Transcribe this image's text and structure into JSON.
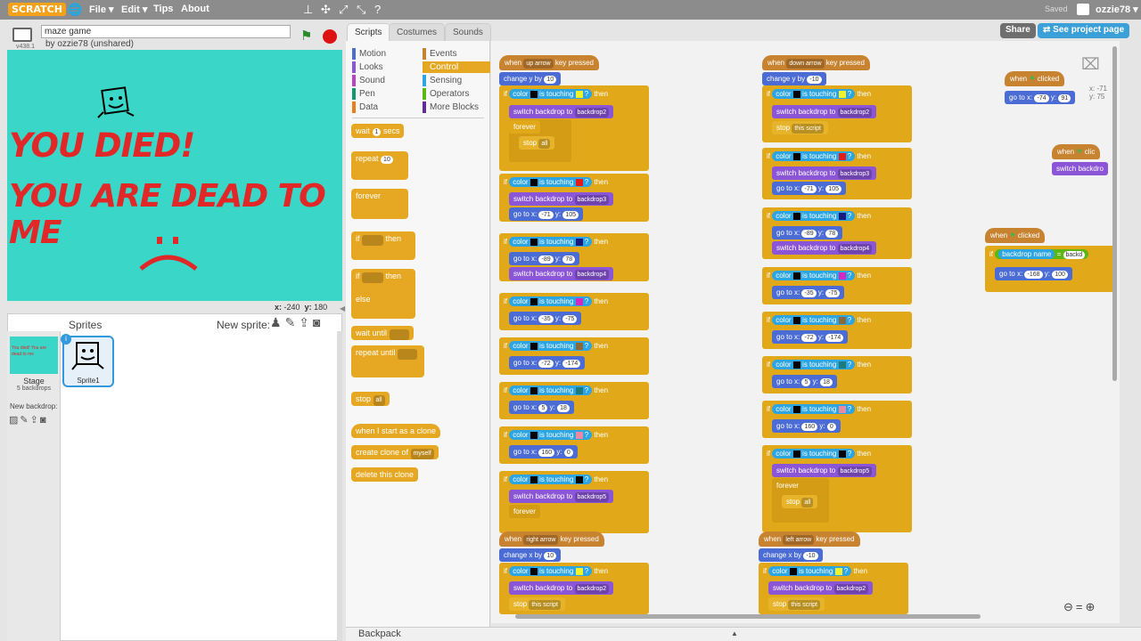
{
  "menubar": {
    "logo": "SCRATCH",
    "file": "File ▾",
    "edit": "Edit ▾",
    "tips": "Tips",
    "about": "About",
    "saved": "Saved",
    "account": "ozzie78 ▾"
  },
  "project": {
    "title": "maze game",
    "byline": "by ozzie78 (unshared)",
    "version": "v438.1"
  },
  "header_buttons": {
    "share": "Share",
    "see_project": "See project page"
  },
  "stage": {
    "line1": "YOU DIED!",
    "line2": "YOU ARE DEAD TO ME",
    "coords_x_label": "x:",
    "coords_x": "-240",
    "coords_y_label": "y:",
    "coords_y": "180"
  },
  "sprites": {
    "header": "Sprites",
    "new_sprite": "New sprite:",
    "stage_label": "Stage",
    "stage_sub": "5 backdrops",
    "new_backdrop": "New backdrop:",
    "sprite1": "Sprite1",
    "stage_thumb_text": "You died! You are dead to me"
  },
  "tabs": [
    "Scripts",
    "Costumes",
    "Sounds"
  ],
  "categories": {
    "left": [
      "Motion",
      "Looks",
      "Sound",
      "Pen",
      "Data"
    ],
    "right": [
      "Events",
      "Control",
      "Sensing",
      "Operators",
      "More Blocks"
    ],
    "colors_left": [
      "#4a6cd4",
      "#8a55d7",
      "#bb42c3",
      "#0e9a6c",
      "#ee7d16"
    ],
    "colors_right": [
      "#c88330",
      "#e1a91a",
      "#2ca5e2",
      "#5cb712",
      "#632d99"
    ]
  },
  "palette": {
    "wait": "wait",
    "wait_val": "1",
    "secs": "secs",
    "repeat": "repeat",
    "repeat_val": "10",
    "forever": "forever",
    "if": "if",
    "then": "then",
    "else": "else",
    "wait_until": "wait until",
    "repeat_until": "repeat until",
    "stop": "stop",
    "stop_val": "all",
    "when_clone": "when I start as a clone",
    "create_clone": "create clone of",
    "myself": "myself",
    "delete_clone": "delete this clone"
  },
  "backpack": "Backpack",
  "scripts": {
    "when": "when",
    "key_pressed": "key pressed",
    "up_arrow": "up arrow",
    "down_arrow": "down arrow",
    "right_arrow": "right arrow",
    "left_arrow": "left arrow",
    "change_y_by": "change y by",
    "change_x_by": "change x by",
    "v10": "10",
    "vm10": "-10",
    "if": "if",
    "then": "then",
    "color": "color",
    "is_touching": "is touching",
    "q": "?",
    "switch_backdrop_to": "switch backdrop to",
    "backdrop2": "backdrop2",
    "backdrop3": "backdrop3",
    "backdrop4": "backdrop4",
    "backdrop5": "backdrop5",
    "forever": "forever",
    "stop": "stop",
    "all": "all",
    "this_script": "this script",
    "go_to_x": "go to x:",
    "y": "y:",
    "gotos_left": [
      [
        "-71",
        "105"
      ],
      [
        "-89",
        "78"
      ],
      [
        "-35",
        "-75"
      ],
      [
        "-72",
        "-174"
      ],
      [
        "5",
        "18"
      ],
      [
        "160",
        "0"
      ]
    ],
    "gotos_right": [
      [
        "-71",
        "105"
      ],
      [
        "-89",
        "78"
      ],
      [
        "-35",
        "-75"
      ],
      [
        "-72",
        "-174"
      ],
      [
        "5",
        "18"
      ],
      [
        "160",
        "0"
      ]
    ],
    "clicked": "clicked",
    "flag_goto": [
      "-74",
      "91"
    ],
    "switch_backdro": "switch backdro",
    "backdrop_name": "backdrop name",
    "backd": "backd",
    "last_goto": [
      "-168",
      "100"
    ],
    "ghost_coords": "x: -71\ny: 75",
    "ghost_x": "x: -71",
    "ghost_y": "y: 75"
  }
}
